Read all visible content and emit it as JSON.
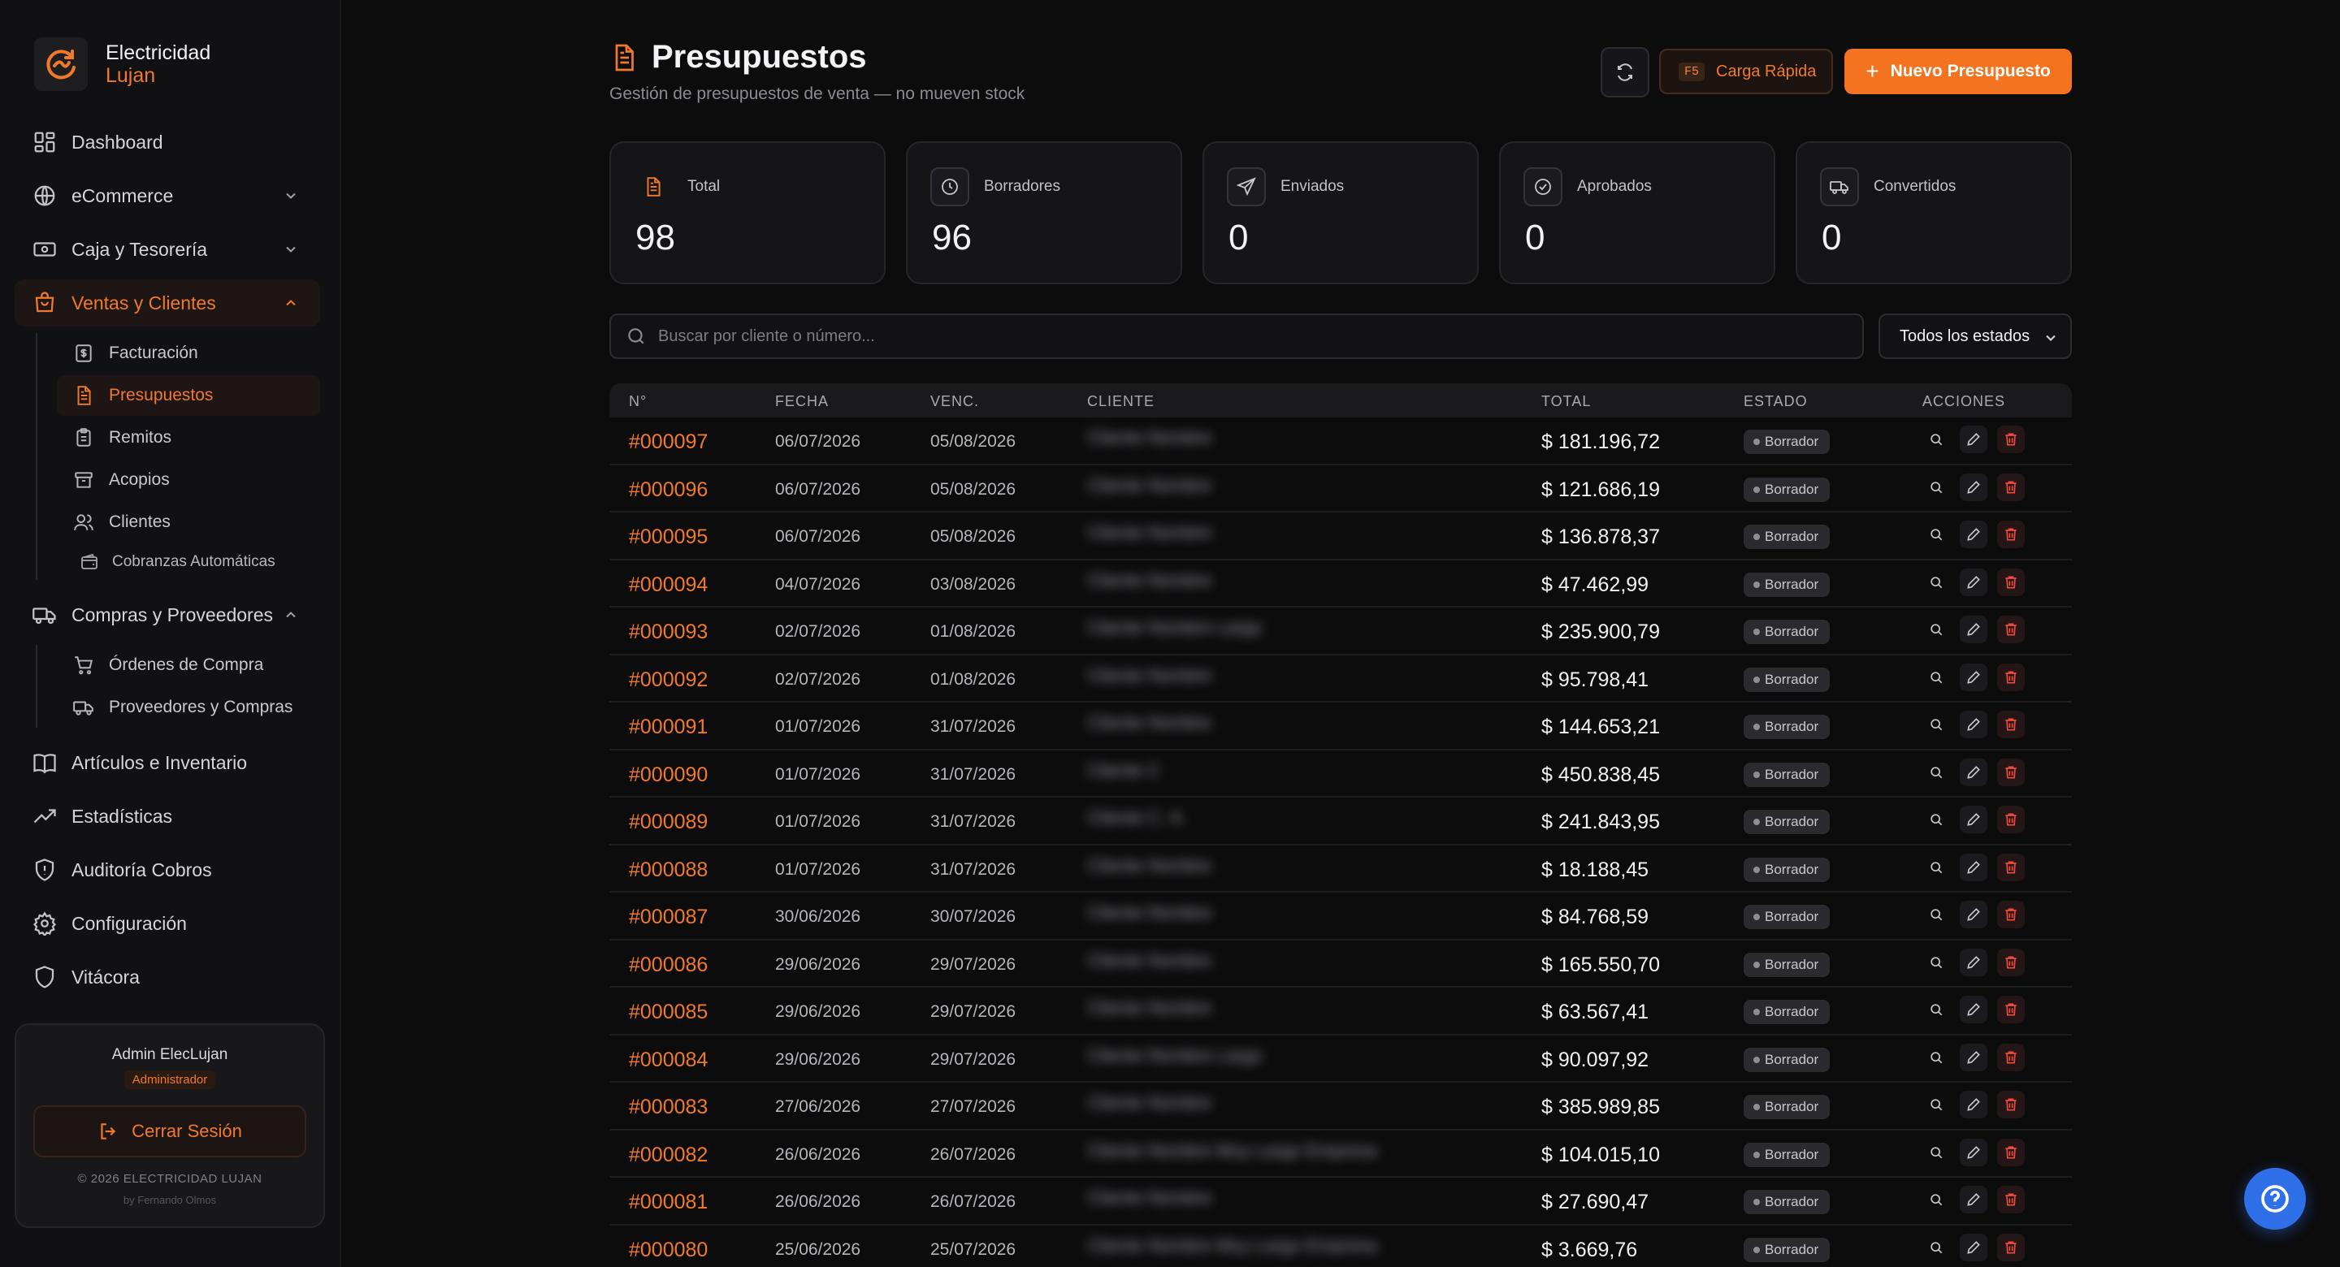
{
  "brand": {
    "line1": "Electricidad",
    "line2": "Lujan"
  },
  "sidebar": {
    "items": [
      {
        "label": "Dashboard",
        "icon": "dashboard-icon"
      },
      {
        "label": "eCommerce",
        "icon": "globe-icon"
      },
      {
        "label": "Caja y Tesorería",
        "icon": "cash-icon"
      },
      {
        "label": "Ventas y Clientes",
        "icon": "bag-icon"
      },
      {
        "label": "Compras y Proveedores",
        "icon": "truck-icon"
      },
      {
        "label": "Artículos e Inventario",
        "icon": "book-icon"
      },
      {
        "label": "Estadísticas",
        "icon": "trend-icon"
      },
      {
        "label": "Auditoría Cobros",
        "icon": "shield-alert-icon"
      },
      {
        "label": "Configuración",
        "icon": "gear-icon"
      },
      {
        "label": "Vitácora",
        "icon": "shield-icon"
      }
    ],
    "ventas_sub": [
      {
        "label": "Facturación",
        "icon": "invoice-icon"
      },
      {
        "label": "Presupuestos",
        "icon": "document-icon"
      },
      {
        "label": "Remitos",
        "icon": "clipboard-icon"
      },
      {
        "label": "Acopios",
        "icon": "archive-icon"
      },
      {
        "label": "Clientes",
        "icon": "users-icon"
      }
    ],
    "clientes_sub": {
      "label": "Cobranzas Automáticas",
      "icon": "wallet-icon"
    },
    "compras_sub": [
      {
        "label": "Órdenes de Compra",
        "icon": "cart-icon"
      },
      {
        "label": "Proveedores y Compras",
        "icon": "truck-icon"
      }
    ]
  },
  "user": {
    "name": "Admin ElecLujan",
    "role": "Administrador",
    "logout_label": "Cerrar Sesión",
    "copyright": "© 2026 ELECTRICIDAD LUJAN",
    "by": "by Fernando Olmos"
  },
  "header": {
    "title": "Presupuestos",
    "subtitle": "Gestión de presupuestos de venta — no mueven stock",
    "quick_key": "F5",
    "quick_label": "Carga Rápida",
    "new_label": "Nuevo Presupuesto"
  },
  "stats": [
    {
      "label": "Total",
      "value": "98",
      "icon": "document-icon"
    },
    {
      "label": "Borradores",
      "value": "96",
      "icon": "clock-icon"
    },
    {
      "label": "Enviados",
      "value": "0",
      "icon": "send-icon"
    },
    {
      "label": "Aprobados",
      "value": "0",
      "icon": "check-circle-icon"
    },
    {
      "label": "Convertidos",
      "value": "0",
      "icon": "truck-icon"
    }
  ],
  "search": {
    "placeholder": "Buscar por cliente o número..."
  },
  "filter": {
    "selected": "Todos los estados"
  },
  "table": {
    "headers": [
      "N°",
      "FECHA",
      "VENC.",
      "CLIENTE",
      "TOTAL",
      "ESTADO",
      "ACCIONES"
    ],
    "rows": [
      {
        "num": "#000097",
        "fecha": "06/07/2026",
        "venc": "05/08/2026",
        "cliente": "Cliente Nombre",
        "total": "$ 181.196,72",
        "estado": "Borrador"
      },
      {
        "num": "#000096",
        "fecha": "06/07/2026",
        "venc": "05/08/2026",
        "cliente": "Cliente Nombre",
        "total": "$ 121.686,19",
        "estado": "Borrador"
      },
      {
        "num": "#000095",
        "fecha": "06/07/2026",
        "venc": "05/08/2026",
        "cliente": "Cliente Nombre",
        "total": "$ 136.878,37",
        "estado": "Borrador"
      },
      {
        "num": "#000094",
        "fecha": "04/07/2026",
        "venc": "03/08/2026",
        "cliente": "Cliente Nombre",
        "total": "$ 47.462,99",
        "estado": "Borrador"
      },
      {
        "num": "#000093",
        "fecha": "02/07/2026",
        "venc": "01/08/2026",
        "cliente": "Cliente Nombre Largo",
        "total": "$ 235.900,79",
        "estado": "Borrador"
      },
      {
        "num": "#000092",
        "fecha": "02/07/2026",
        "venc": "01/08/2026",
        "cliente": "Cliente Nombre",
        "total": "$ 95.798,41",
        "estado": "Borrador"
      },
      {
        "num": "#000091",
        "fecha": "01/07/2026",
        "venc": "31/07/2026",
        "cliente": "Cliente Nombre",
        "total": "$ 144.653,21",
        "estado": "Borrador"
      },
      {
        "num": "#000090",
        "fecha": "01/07/2026",
        "venc": "31/07/2026",
        "cliente": "Cliente C",
        "total": "$ 450.838,45",
        "estado": "Borrador"
      },
      {
        "num": "#000089",
        "fecha": "01/07/2026",
        "venc": "31/07/2026",
        "cliente": "Cliente C. A.",
        "total": "$ 241.843,95",
        "estado": "Borrador"
      },
      {
        "num": "#000088",
        "fecha": "01/07/2026",
        "venc": "31/07/2026",
        "cliente": "Cliente Nombre",
        "total": "$ 18.188,45",
        "estado": "Borrador"
      },
      {
        "num": "#000087",
        "fecha": "30/06/2026",
        "venc": "30/07/2026",
        "cliente": "Cliente Nombre",
        "total": "$ 84.768,59",
        "estado": "Borrador"
      },
      {
        "num": "#000086",
        "fecha": "29/06/2026",
        "venc": "29/07/2026",
        "cliente": "Cliente Nombre",
        "total": "$ 165.550,70",
        "estado": "Borrador"
      },
      {
        "num": "#000085",
        "fecha": "29/06/2026",
        "venc": "29/07/2026",
        "cliente": "Cliente Nombre",
        "total": "$ 63.567,41",
        "estado": "Borrador"
      },
      {
        "num": "#000084",
        "fecha": "29/06/2026",
        "venc": "29/07/2026",
        "cliente": "Cliente Nombre Largo",
        "total": "$ 90.097,92",
        "estado": "Borrador"
      },
      {
        "num": "#000083",
        "fecha": "27/06/2026",
        "venc": "27/07/2026",
        "cliente": "Cliente Nombre",
        "total": "$ 385.989,85",
        "estado": "Borrador"
      },
      {
        "num": "#000082",
        "fecha": "26/06/2026",
        "venc": "26/07/2026",
        "cliente": "Cliente Nombre Muy Largo Empresa",
        "total": "$ 104.015,10",
        "estado": "Borrador"
      },
      {
        "num": "#000081",
        "fecha": "26/06/2026",
        "venc": "26/07/2026",
        "cliente": "Cliente Nombre",
        "total": "$ 27.690,47",
        "estado": "Borrador"
      },
      {
        "num": "#000080",
        "fecha": "25/06/2026",
        "venc": "25/07/2026",
        "cliente": "Cliente Nombre Muy Largo Empresa",
        "total": "$ 3.669,76",
        "estado": "Borrador"
      }
    ]
  },
  "colors": {
    "accent": "#f47321",
    "background": "#0c0c0d",
    "help": "#2f6fe8",
    "delete": "#ef4a3a"
  }
}
